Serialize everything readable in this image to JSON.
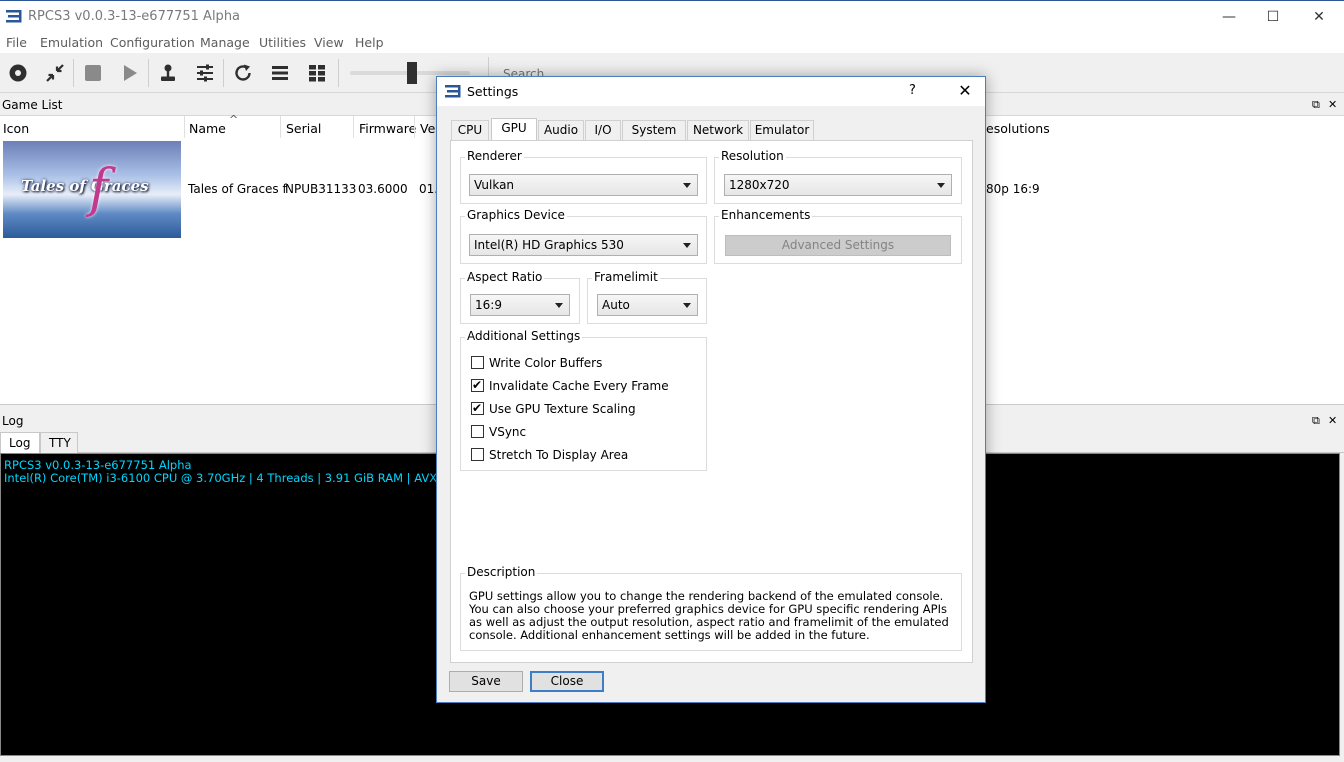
{
  "window": {
    "title": "RPCS3 v0.0.3-13-e677751 Alpha",
    "minimize": "—",
    "maximize": "☐",
    "close": "✕"
  },
  "menu": [
    "File",
    "Emulation",
    "Configuration",
    "Manage",
    "Utilities",
    "View",
    "Help"
  ],
  "toolbar": {
    "search_placeholder": "Search..."
  },
  "game_list": {
    "title": "Game List",
    "float_glyph": "⧉",
    "close_glyph": "✕",
    "sort_indicator": "^",
    "columns": [
      "Icon",
      "Name",
      "Serial",
      "Firmware",
      "Ver",
      "esolutions"
    ],
    "row": {
      "icon_text": "Tales of Graces",
      "icon_f": "f",
      "name": "Tales of Graces f",
      "serial": "NPUB31133",
      "firmware": "03.6000",
      "version": "01.0",
      "resolutions": "80p 16:9"
    }
  },
  "log": {
    "title": "Log",
    "tabs": [
      "Log",
      "TTY"
    ],
    "lines": [
      "RPCS3 v0.0.3-13-e677751 Alpha",
      "Intel(R) Core(TM) i3-6100 CPU @ 3.70GHz | 4 Threads | 3.91 GiB RAM | AVX"
    ]
  },
  "settings": {
    "title": "Settings",
    "help": "?",
    "close": "✕",
    "tabs": [
      "CPU",
      "GPU",
      "Audio",
      "I/O",
      "System",
      "Network",
      "Emulator"
    ],
    "active_tab": "GPU",
    "renderer": {
      "label": "Renderer",
      "value": "Vulkan"
    },
    "resolution": {
      "label": "Resolution",
      "value": "1280x720"
    },
    "graphics_device": {
      "label": "Graphics Device",
      "value": "Intel(R) HD Graphics 530"
    },
    "enhancements": {
      "label": "Enhancements",
      "button": "Advanced Settings"
    },
    "aspect_ratio": {
      "label": "Aspect Ratio",
      "value": "16:9"
    },
    "framelimit": {
      "label": "Framelimit",
      "value": "Auto"
    },
    "additional": {
      "label": "Additional Settings",
      "options": [
        {
          "label": "Write Color Buffers",
          "checked": false
        },
        {
          "label": "Invalidate Cache Every Frame",
          "checked": true
        },
        {
          "label": "Use GPU Texture Scaling",
          "checked": true
        },
        {
          "label": "VSync",
          "checked": false
        },
        {
          "label": "Stretch To Display Area",
          "checked": false
        }
      ]
    },
    "description": {
      "label": "Description",
      "text": "GPU settings allow you to change the rendering backend of the emulated console. You can also choose your preferred graphics device for GPU specific rendering APIs as well as adjust the output resolution, aspect ratio and framelimit of the emulated console. Additional enhancement settings will be added in the future."
    },
    "save": "Save",
    "close_button": "Close"
  },
  "colors": {
    "accent": "#3c7fc6",
    "log_text": "#00d6ff",
    "log_bg": "#000000"
  }
}
